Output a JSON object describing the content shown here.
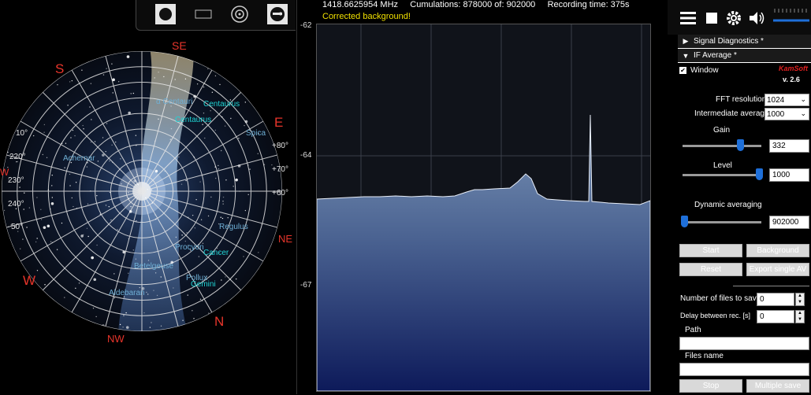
{
  "sky": {
    "compass": {
      "se": "SE",
      "s": "S",
      "e": "E",
      "w_edge": "W",
      "ne": "NE",
      "w": "W",
      "nw": "NW",
      "n": "N"
    },
    "altitudes": {
      "a80": "+80°",
      "a70": "+70°",
      "a60": "+60°",
      "a50": "50°",
      "a10": "10°"
    },
    "azimuths": {
      "az220": "220°",
      "az230": "230°",
      "az240": "240°"
    },
    "stars": {
      "acentauri": "α Centauri",
      "achernar": "Achernar",
      "spica": "Spica",
      "regulus": "Regulus",
      "procyon": "Procyon",
      "betelgeuse": "Betelgeuse",
      "pollux": "Pollux",
      "aldebaran": "Aldebaran"
    },
    "constellations": {
      "centaurus1": "Centaurus",
      "centaurus2": "Centaurus",
      "cancer": "Cancer",
      "gemini": "Gemini"
    }
  },
  "spectrum": {
    "frequency": "1418.6625954 MHz",
    "cumulations": "Cumulations: 878000 of: 902000",
    "recording": "Recording time: 375s",
    "status": "Corrected background!",
    "y_ticks": [
      "-62",
      "-64",
      "-67"
    ],
    "colors": {
      "status": "#f0e000",
      "fill_top": "#7d97b8",
      "fill_bottom": "#0d1a5a"
    }
  },
  "panel": {
    "sections": {
      "signal_diag": "Signal Diagnostics *",
      "if_avg": "IF Average *"
    },
    "window_label": "Window",
    "brand": "KamSoft",
    "version": "v. 2.6",
    "fft_label": "FFT resolution",
    "fft_value": "1024",
    "inter_label": "Intermediate average",
    "inter_value": "1000",
    "gain_label": "Gain",
    "gain_value": "332",
    "gain_level": 0.73,
    "level_label": "Level",
    "level_value": "1000",
    "level_level": 0.97,
    "dyn_label": "Dynamic averaging",
    "dyn_value": "902000",
    "dyn_level": 0.02,
    "btn_start": "Start",
    "btn_background": "Background",
    "btn_reset": "Reset",
    "btn_export": "Export single AV",
    "files_label": "Number of files to save",
    "files_value": "0",
    "delay_label": "Delay between rec. [s]",
    "delay_value": "0",
    "path_label": "Path",
    "files_name_label": "Files name",
    "btn_stop": "Stop",
    "btn_multi": "Multiple save"
  }
}
